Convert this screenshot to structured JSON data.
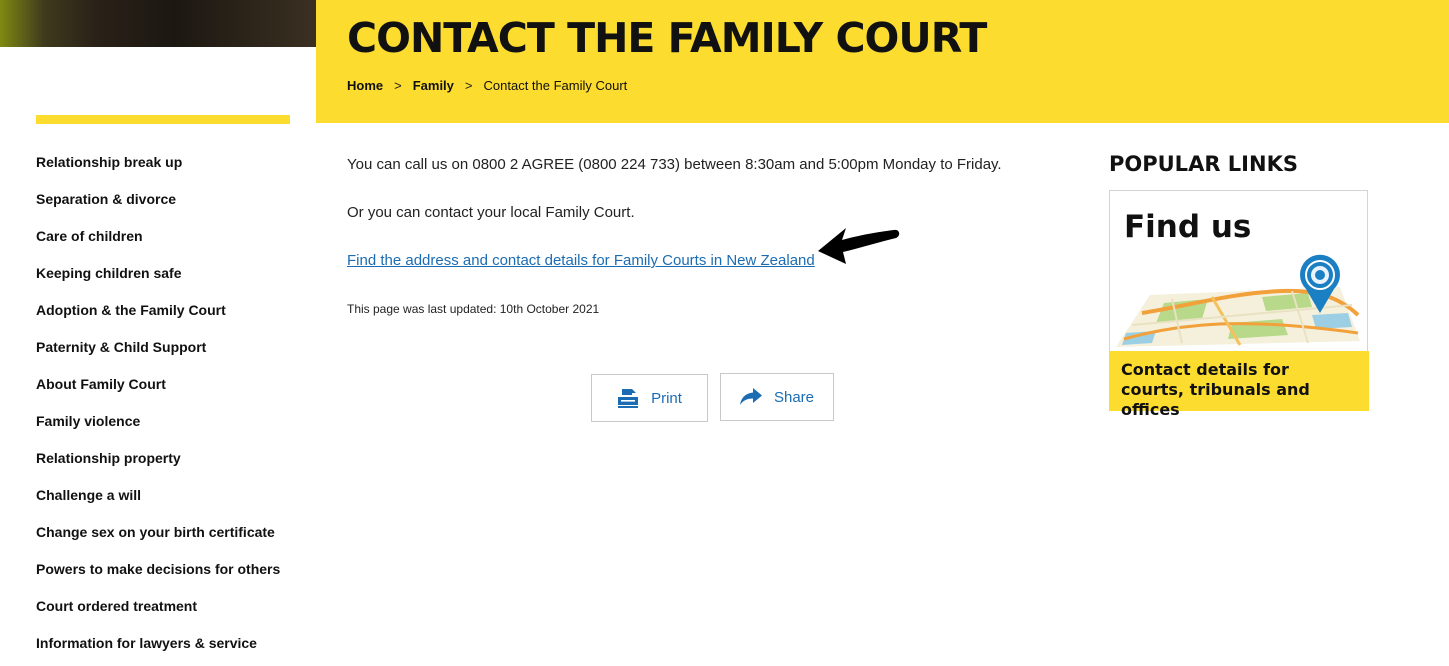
{
  "header": {
    "title": "CONTACT THE FAMILY COURT",
    "breadcrumb": [
      {
        "label": "Home"
      },
      {
        "label": "Family"
      },
      {
        "label": "Contact the Family Court"
      }
    ],
    "breadcrumb_separator": ">"
  },
  "sidebar": {
    "items": [
      {
        "label": "Relationship break up"
      },
      {
        "label": "Separation & divorce"
      },
      {
        "label": "Care of children"
      },
      {
        "label": "Keeping children safe"
      },
      {
        "label": "Adoption & the Family Court"
      },
      {
        "label": "Paternity & Child Support"
      },
      {
        "label": "About Family Court"
      },
      {
        "label": "Family violence"
      },
      {
        "label": "Relationship property"
      },
      {
        "label": "Challenge a will"
      },
      {
        "label": "Change sex on your birth certificate"
      },
      {
        "label": "Powers to make decisions for others"
      },
      {
        "label": "Court ordered treatment"
      },
      {
        "label": "Information for lawyers & service"
      }
    ]
  },
  "main": {
    "call_text": "You can call us on 0800 2 AGREE (0800 224 733) between 8:30am and 5:00pm Monday to Friday.",
    "local_text": "Or you can contact your local Family Court.",
    "find_link": "Find the address and contact details for Family Courts in New Zealand",
    "last_updated": "This page was last updated: 10th October 2021",
    "actions": {
      "print_label": "Print",
      "share_label": "Share"
    }
  },
  "popular": {
    "heading": "POPULAR LINKS",
    "card": {
      "title": "Find us",
      "caption": "Contact details for courts, tribunals and offices"
    }
  },
  "icons": {
    "print": "printer-icon",
    "share": "share-arrow-icon",
    "pin": "map-pin-icon",
    "annotation": "arrow-annotation"
  },
  "colors": {
    "brand_yellow": "#fddc30",
    "link_blue": "#1b6cb3",
    "text_dark": "#111111"
  }
}
